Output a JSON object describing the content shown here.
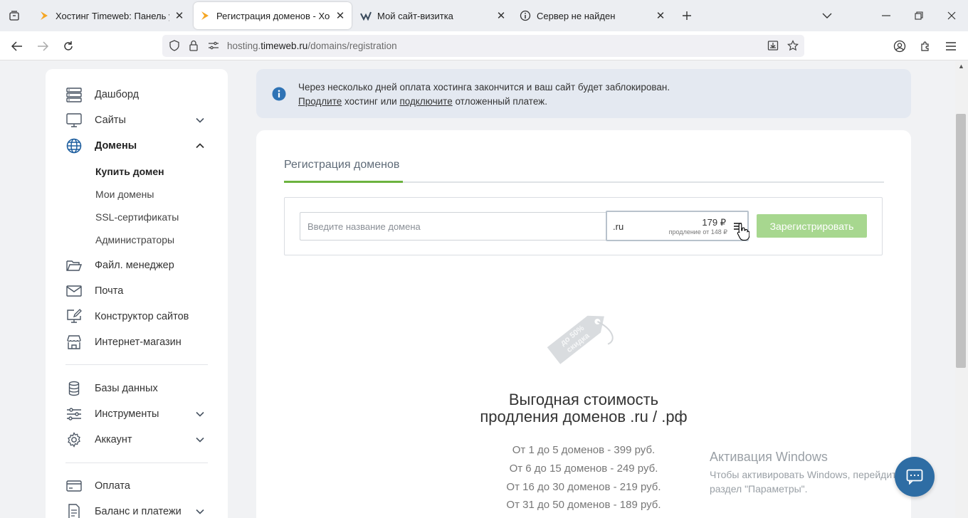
{
  "browser": {
    "tabs": [
      {
        "title": "Хостинг Timeweb: Панель упра",
        "active": false
      },
      {
        "title": "Регистрация доменов - Хости",
        "active": true
      },
      {
        "title": "Мой сайт-визитка",
        "active": false
      },
      {
        "title": "Сервер не найден",
        "active": false
      }
    ],
    "url_prefix": "hosting.",
    "url_domain": "timeweb.ru",
    "url_path": "/domains/registration"
  },
  "sidebar": {
    "items": [
      {
        "label": "Дашборд"
      },
      {
        "label": "Сайты"
      },
      {
        "label": "Домены"
      },
      {
        "label": "Файл. менеджер"
      },
      {
        "label": "Почта"
      },
      {
        "label": "Конструктор сайтов"
      },
      {
        "label": "Интернет-магазин"
      },
      {
        "label": "Базы данных"
      },
      {
        "label": "Инструменты"
      },
      {
        "label": "Аккаунт"
      },
      {
        "label": "Оплата"
      },
      {
        "label": "Баланс и платежи"
      }
    ],
    "domains_sub": [
      {
        "label": "Купить домен"
      },
      {
        "label": "Мои домены"
      },
      {
        "label": "SSL-сертификаты"
      },
      {
        "label": "Администраторы"
      }
    ]
  },
  "notice": {
    "line1": "Через несколько дней оплата хостинга закончится и ваш сайт будет заблокирован.",
    "link1": "Продлите",
    "mid": " хостинг или ",
    "link2": "подключите",
    "tail": " отложенный платеж."
  },
  "main": {
    "tab_label": "Регистрация доменов",
    "domain_placeholder": "Введите название домена",
    "zone": ".ru",
    "zone_price": "179 ₽",
    "zone_renew": "продление от 148 ₽",
    "register_button": "Зарегистрировать",
    "promo_tag": "до 50% скидка",
    "promo_title_1": "Выгодная стоимость",
    "promo_title_2": "продления доменов .ru / .рф",
    "price_lines": [
      "От 1 до 5 доменов - 399 руб.",
      "От 6 до 15 доменов - 249 руб.",
      "От 16 до 30 доменов - 219 руб.",
      "От 31 до 50 доменов - 189 руб."
    ]
  },
  "windows": {
    "activate_title": "Активация Windows",
    "activate_sub": "Чтобы активировать Windows, перейдите в раздел \"Параметры\"."
  },
  "colors": {
    "accent_green": "#6cb33f",
    "button_green": "#a7d78f",
    "notice_bg": "#e4e9f1",
    "chat_blue": "#2e6da4"
  }
}
